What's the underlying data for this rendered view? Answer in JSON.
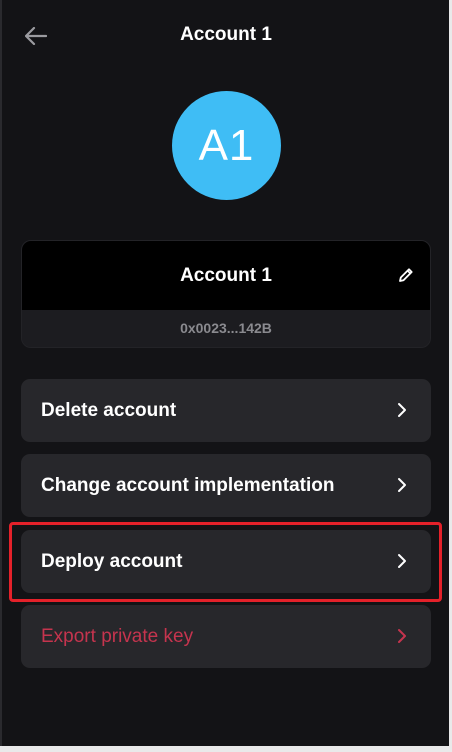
{
  "header": {
    "title": "Account 1",
    "back_icon": "arrow-left-icon"
  },
  "avatar": {
    "initials": "A1",
    "color": "#3fbdf5"
  },
  "account_card": {
    "name": "Account 1",
    "address": "0x0023...142B",
    "edit_icon": "pencil-icon"
  },
  "menu": {
    "items": [
      {
        "label": "Delete account",
        "icon": "chevron-right-icon"
      },
      {
        "label": "Change account implementation",
        "icon": "chevron-right-icon"
      },
      {
        "label": "Deploy account",
        "icon": "chevron-right-icon"
      },
      {
        "label": "Export private key",
        "icon": "chevron-right-icon",
        "color": "#c5344e"
      }
    ]
  },
  "highlight": {
    "target": "Deploy account",
    "color": "#e4212a"
  }
}
